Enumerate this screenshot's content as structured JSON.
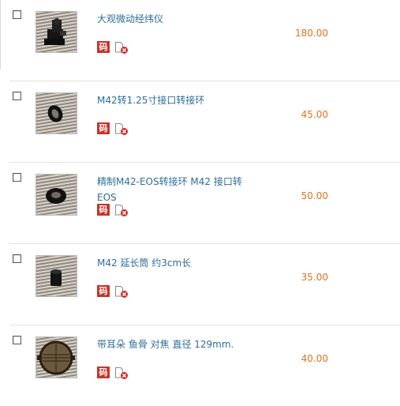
{
  "items": [
    {
      "title": "大观微动经纬仪",
      "price": "180.00",
      "code_icon_label": "码",
      "image": "theodolite-mount-photo"
    },
    {
      "title": "M42转1.25寸接口转接环",
      "price": "45.00",
      "code_icon_label": "码",
      "image": "ring-adapter-photo"
    },
    {
      "title": "精制M42-EOS转接环 M42 接口转EOS",
      "price": "50.00",
      "code_icon_label": "码",
      "image": "eos-adapter-photo"
    },
    {
      "title": "M42 延长筒 约3cm长",
      "price": "35.00",
      "code_icon_label": "码",
      "image": "extension-tube-photo"
    },
    {
      "title": "带耳朵 鱼骨 对焦 直径 129mm.",
      "price": "40.00",
      "code_icon_label": "码",
      "image": "bahtinov-mask-photo"
    }
  ],
  "colors": {
    "title_link": "#2e6d98",
    "price": "#e0721e",
    "code_icon": "#c8342a",
    "delete_badge": "#d42a2a"
  },
  "icons": [
    "checkbox",
    "code-icon",
    "delete-document-icon"
  ]
}
